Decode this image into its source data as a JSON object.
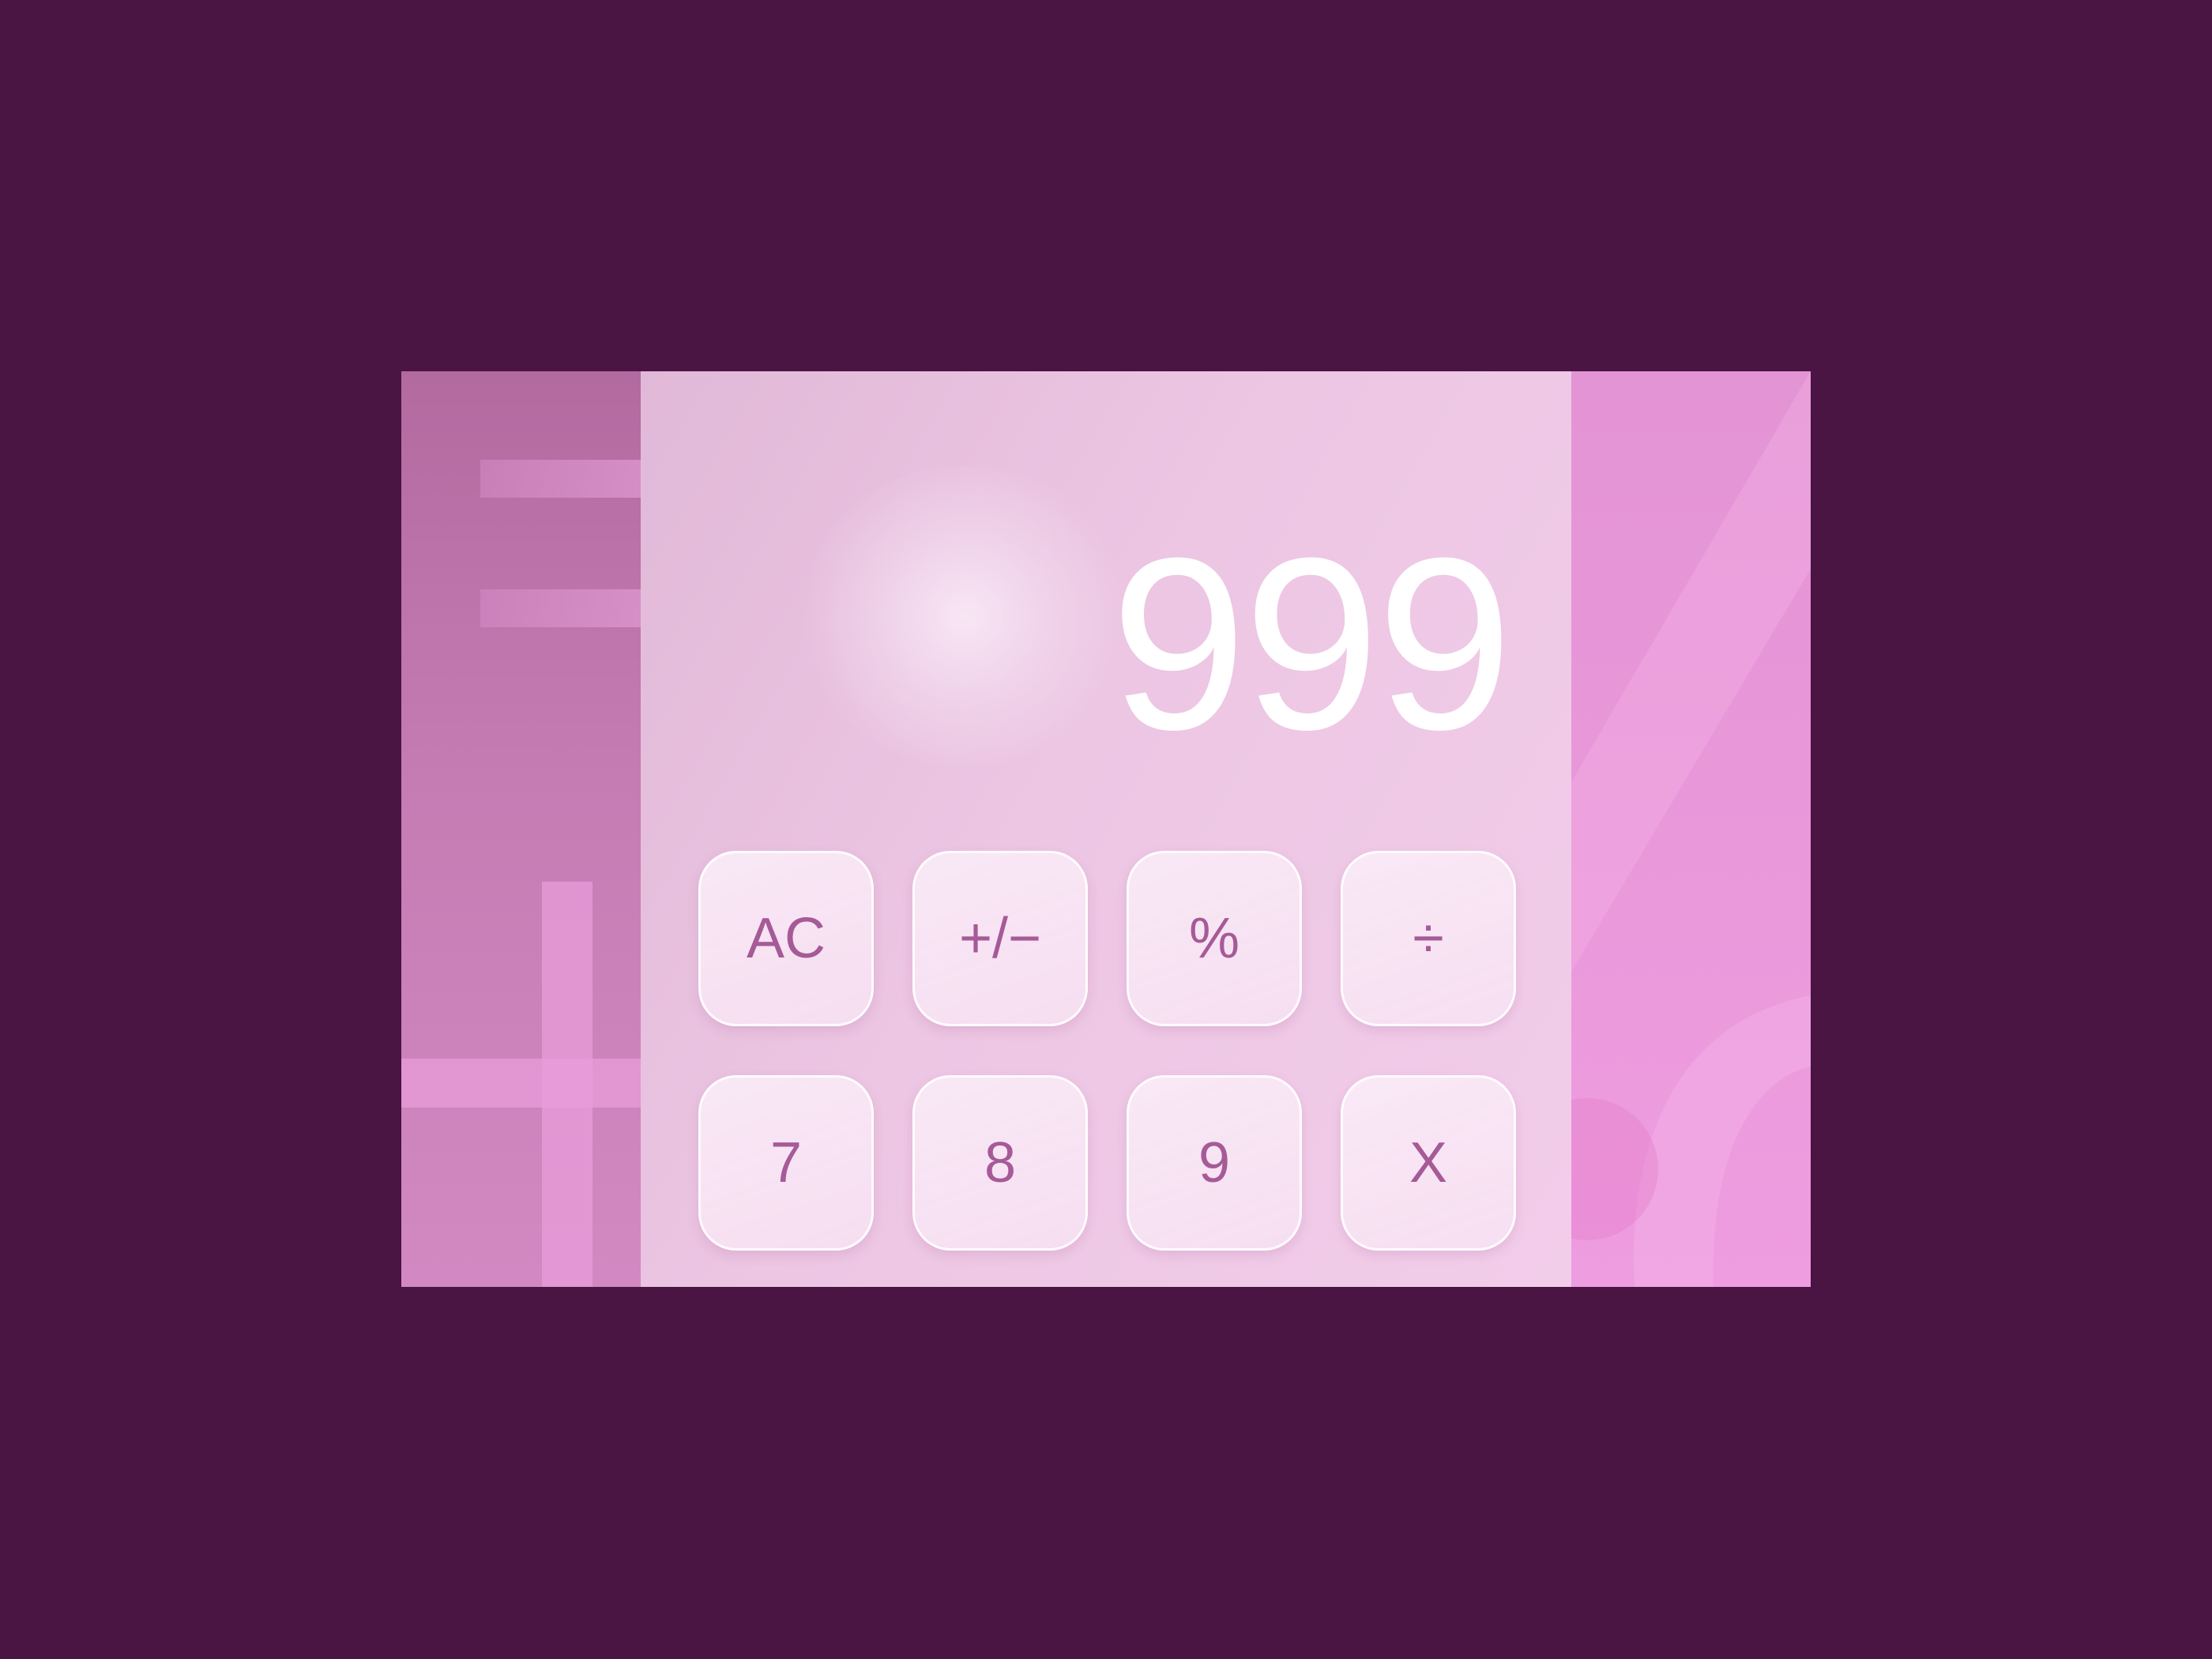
{
  "calculator": {
    "display_value": "999",
    "keys": [
      {
        "label": "AC"
      },
      {
        "label": "+/−"
      },
      {
        "label": "%"
      },
      {
        "label": "÷"
      },
      {
        "label": "7"
      },
      {
        "label": "8"
      },
      {
        "label": "9"
      },
      {
        "label": "X"
      }
    ]
  },
  "colors": {
    "background": "#4a1443",
    "key_text": "#a65a97",
    "display_text": "#ffffff"
  }
}
